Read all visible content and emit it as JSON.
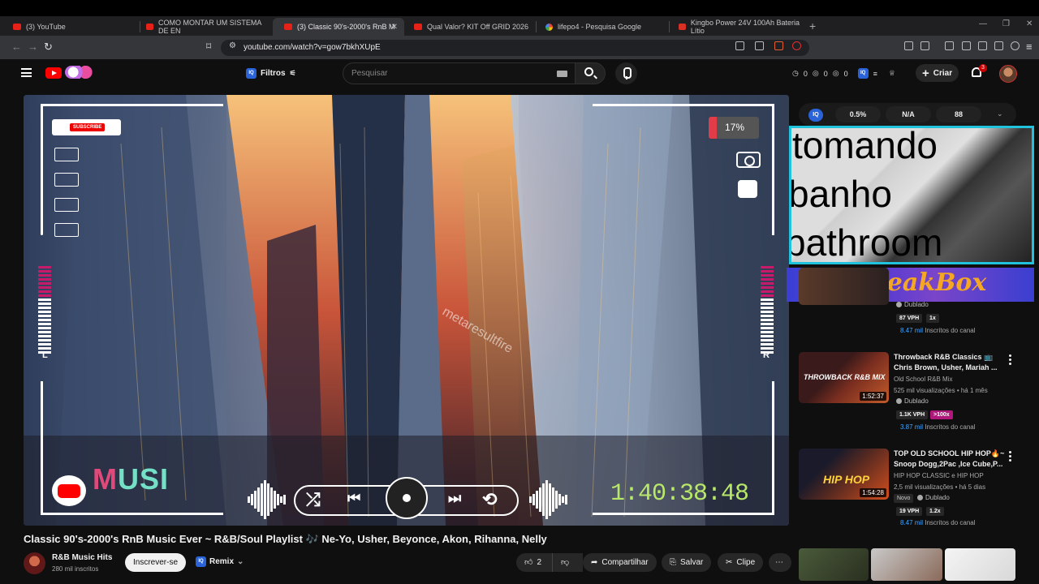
{
  "browser": {
    "tabs": [
      {
        "label": "(3) YouTube",
        "icon": "youtube-icon"
      },
      {
        "label": "COMO MONTAR UM SISTEMA DE EN",
        "icon": "youtube-icon"
      },
      {
        "label": "(3) Classic 90's-2000's RnB M",
        "icon": "youtube-icon",
        "active": true
      },
      {
        "label": "Qual Valor? KIT Off GRID 2026",
        "icon": "youtube-icon"
      },
      {
        "label": "lifepo4 - Pesquisa Google",
        "icon": "google-icon"
      },
      {
        "label": "Kingbo Power 24V 100Ah Bateria Lítio",
        "icon": "store-icon"
      }
    ],
    "url": "youtube.com/watch?v=gow7bkhXUpE"
  },
  "header": {
    "filters_label": "Filtros",
    "search_placeholder": "Pesquisar",
    "stats": [
      "0",
      "0",
      "0"
    ],
    "create_label": "Criar",
    "notification_count": "3"
  },
  "player": {
    "subscribe_badge": "SUBSCRIBE",
    "percent": "17%",
    "left_label": "L",
    "right_label": "R",
    "musi_text": "USI",
    "musi_m": "M",
    "timecode": "1:40:38:48",
    "watermark": "metaresultfire"
  },
  "video": {
    "title": "Classic 90's-2000's RnB Music Ever ~ R&B/Soul Playlist 🎶 Ne-Yo, Usher, Beyonce, Akon, Rihanna, Nelly",
    "channel": "R&B Music Hits",
    "subscribers": "280 mil inscritos",
    "subscribe_label": "Inscrever-se",
    "remix_label": "Remix",
    "likes": "2",
    "share_label": "Compartilhar",
    "save_label": "Salvar",
    "clip_label": "Clipe"
  },
  "sidebar": {
    "iq_stats": [
      "0.5%",
      "N/A",
      "88"
    ],
    "overlay_lines": [
      "tomando",
      "banho",
      "bathroom"
    ],
    "banner_text": "PeakBox",
    "first_partial": {
      "dub": "Dublado",
      "vph": "87 VPH",
      "chip": "1x",
      "subs": "8.47 mil",
      "subs_suffix": "Inscritos do canal"
    },
    "recommendations": [
      {
        "title": "Throwback R&B Classics 📺 Chris Brown, Usher, Mariah ...",
        "channel": "Old School R&B Mix",
        "meta": "525 mil visualizações • há 1 mês",
        "dub": "Dublado",
        "duration": "1:52:37",
        "vph": "1.1K VPH",
        "chip": ">100x",
        "subs": "3.87 mil",
        "subs_suffix": "Inscritos do canal"
      },
      {
        "title": "TOP OLD SCHOOL HIP HOP🔥~ Snoop Dogg,2Pac ,Ice Cube,P...",
        "channel": "HIP HOP CLASSIC e HIP HOP",
        "meta": "2,5 mil visualizações • há 5 dias",
        "badge": "Novo",
        "dub": "Dublado",
        "duration": "1:54:28",
        "vph": "19 VPH",
        "chip": "1.2x",
        "subs": "8.47 mil",
        "subs_suffix": "Inscritos do canal"
      }
    ]
  },
  "colors": {
    "accent": "#ff0000",
    "overlay_border": "#21c3dc",
    "timecode": "#b8e86a",
    "link": "#3ea6ff"
  }
}
